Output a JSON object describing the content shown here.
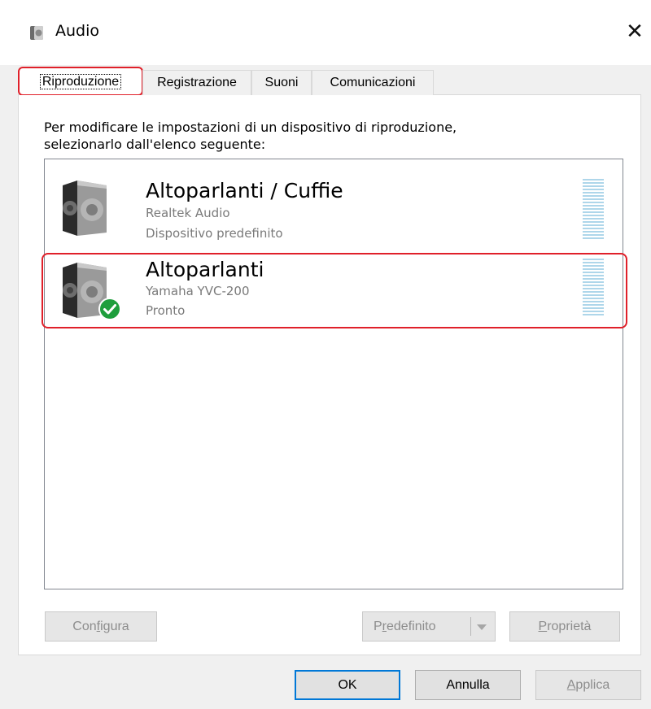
{
  "window": {
    "title": "Audio",
    "close_glyph": "✕",
    "title_icon": "speaker-icon"
  },
  "tabs": [
    {
      "label": "Riproduzione",
      "active": true
    },
    {
      "label": "Registrazione",
      "active": false
    },
    {
      "label": "Suoni",
      "active": false
    },
    {
      "label": "Comunicazioni",
      "active": false
    }
  ],
  "instructions": {
    "line1": "Per modificare le impostazioni di un dispositivo di riproduzione,",
    "line2": "selezionarlo dall'elenco seguente:"
  },
  "devices": [
    {
      "name": "Altoparlanti / Cuffie",
      "driver": "Realtek Audio",
      "status": "Dispositivo predefinito",
      "icon": "speaker-icon",
      "badge": null
    },
    {
      "name": "Altoparlanti",
      "driver": "Yamaha YVC-200",
      "status": "Pronto",
      "icon": "speaker-icon",
      "badge": "green-check-icon"
    }
  ],
  "list_buttons": {
    "configure": {
      "pre": "Con",
      "key": "f",
      "post": "igura"
    },
    "default": {
      "pre": "P",
      "key": "r",
      "post": "edefinito"
    },
    "properties": {
      "pre": "",
      "key": "P",
      "post": "roprietà"
    }
  },
  "dialog_buttons": {
    "ok": "OK",
    "cancel": "Annulla",
    "apply": {
      "pre": "",
      "key": "A",
      "post": "pplica"
    }
  },
  "colors": {
    "highlight": "#e0202a",
    "meter": "#aed6ea",
    "check": "#1e9e3c",
    "focus": "#0078d7"
  }
}
